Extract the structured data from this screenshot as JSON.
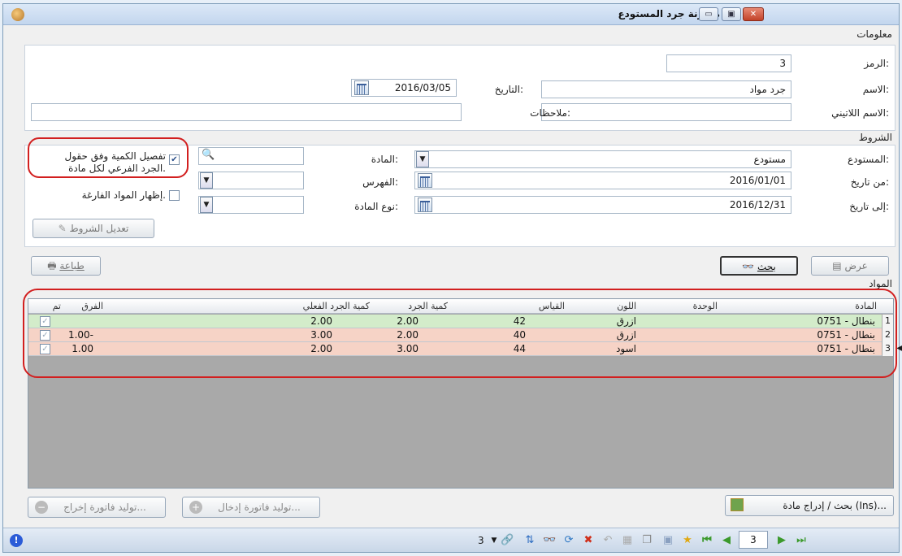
{
  "window": {
    "title": "مقارنة جرد المستودع"
  },
  "info": {
    "section_label": "معلومات",
    "code_label": "الرمز:",
    "code_value": "3",
    "name_label": "الاسم:",
    "name_value": "جرد مواد",
    "latin_name_label": "الاسم اللاتيني:",
    "latin_name_value": "",
    "date_label": "التاريخ:",
    "date_value": "2016/03/05",
    "notes_label": "ملاحظات:",
    "notes_value": ""
  },
  "conditions": {
    "section_label": "الشروط",
    "warehouse_label": "المستودع:",
    "warehouse_value": "مستودع",
    "from_date_label": "من تاريخ:",
    "from_date_value": "2016/01/01",
    "to_date_label": "إلى تاريخ:",
    "to_date_value": "2016/12/31",
    "material_label": "المادة:",
    "material_value": "",
    "index_label": "الفهرس:",
    "index_value": "",
    "material_type_label": "نوع المادة:",
    "material_type_value": "",
    "detail_qty_label_line1": "تفصيل الكمية وفق حقول",
    "detail_qty_label_line2": "الجرد الفرعي لكل مادة.",
    "detail_qty_checked": true,
    "show_empty_label": "إظهار المواد الفارغة.",
    "show_empty_checked": false,
    "edit_conditions_button": "تعديل الشروط"
  },
  "actions": {
    "view_button": "عرض",
    "search_button": "بحث",
    "print_button": "طباعة"
  },
  "materials": {
    "section_label": "المواد",
    "columns": {
      "material": "المادة",
      "unit": "الوحدة",
      "color": "اللون",
      "size": "القياس",
      "inventory_qty": "كمية الجرد",
      "actual_qty": "كمية الجرد الفعلي",
      "difference": "الفرق",
      "done": "تم"
    },
    "rows": [
      {
        "num": "1",
        "material": "0751 - بنطال",
        "unit": "",
        "color": "ازرق",
        "size": "42",
        "inventory_qty": "2.00",
        "actual_qty": "2.00",
        "difference": "",
        "done": true,
        "bg": "#d3ecca"
      },
      {
        "num": "2",
        "material": "0751 - بنطال",
        "unit": "",
        "color": "ازرق",
        "size": "40",
        "inventory_qty": "2.00",
        "actual_qty": "3.00",
        "difference": "1.00-",
        "done": true,
        "bg": "#f6d3c6"
      },
      {
        "num": "3",
        "material": "0751 - بنطال",
        "unit": "",
        "color": "اسود",
        "size": "44",
        "inventory_qty": "3.00",
        "actual_qty": "2.00",
        "difference": "1.00",
        "done": true,
        "bg": "#f6d3c6"
      }
    ]
  },
  "bottom": {
    "search_insert_button": "بحث / إدراج مادة (Ins)...",
    "gen_input_invoice_button": "توليد فاتورة إدخال...",
    "gen_output_invoice_button": "توليد فاتورة إخراج..."
  },
  "status": {
    "page_number": "3",
    "record_counter": "3"
  },
  "colors": {
    "highlight_red": "#d21f1f",
    "row_ok": "#d3ecca",
    "row_diff": "#f6d3c6"
  }
}
